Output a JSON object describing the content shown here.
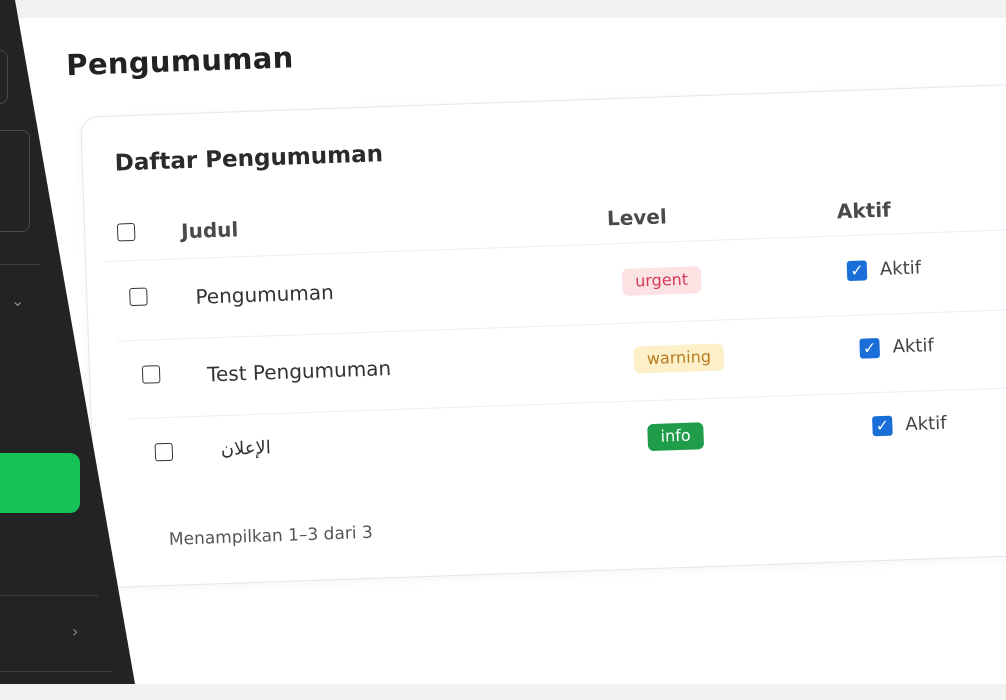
{
  "page": {
    "title": "Pengumuman"
  },
  "card": {
    "title": "Daftar Pengumuman",
    "columns": {
      "title": "Judul",
      "level": "Level",
      "active": "Aktif"
    },
    "rows": [
      {
        "title": "Pengumuman",
        "level": "urgent",
        "active_label": "Aktif",
        "active": true
      },
      {
        "title": "Test Pengumuman",
        "level": "warning",
        "active_label": "Aktif",
        "active": true
      },
      {
        "title": "الإعلان",
        "level": "info",
        "active_label": "Aktif",
        "active": true
      }
    ],
    "footer": "Menampilkan 1–3 dari 3"
  },
  "colors": {
    "sidebar_bg": "#232323",
    "sidebar_active": "#14c258",
    "urgent_bg": "#fde2e4",
    "urgent_text": "#d13a55",
    "warning_bg": "#fdf0c8",
    "warning_text": "#b7791f",
    "info_bg": "#1f9d4b",
    "info_text": "#ffffff",
    "checkbox_checked": "#1a6ed8"
  },
  "icons": [
    "chevron-down-icon",
    "chevron-right-icon",
    "checkmark-icon"
  ]
}
